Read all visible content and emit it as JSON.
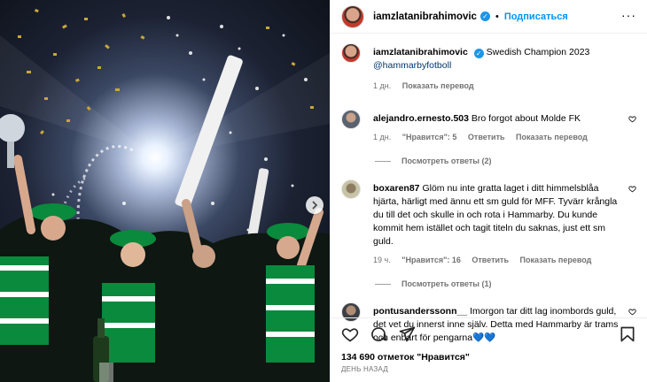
{
  "post": {
    "username": "iamzlatanibrahimovic",
    "follow_label": "Подписаться",
    "dot": "•",
    "caption_text": "Swedish Champion 2023",
    "caption_tag": "@hammarbyfotboll",
    "caption_time": "1 дн.",
    "caption_translate": "Показать перевод"
  },
  "comments": [
    {
      "user": "alejandro.ernesto.503",
      "text": "Bro forgot about Molde FK",
      "time": "1 дн.",
      "likes": "\"Нравится\": 5",
      "reply": "Ответить",
      "translate": "Показать перевод",
      "replies": "Посмотреть ответы (2)"
    },
    {
      "user": "boxaren87",
      "text": "Glöm nu inte gratta laget i ditt himmelsblåa hjärta, härligt med ännu ett sm guld för MFF. Tyvärr krångla du till det och skulle in och rota i Hammarby. Du kunde kommit hem istället och tagit titeln du saknas, just ett sm guld.",
      "time": "19 ч.",
      "likes": "\"Нравится\": 16",
      "reply": "Ответить",
      "translate": "Показать перевод",
      "replies": "Посмотреть ответы (1)"
    },
    {
      "user": "pontusanderssonn__",
      "text": "Imorgon tar ditt lag inombords guld, det vet du innerst inne själv. Detta med Hammarby är trams och enbart för pengarna💙💙"
    }
  ],
  "actions": {
    "likes": "134 690 отметок \"Нравится\"",
    "date": "ДЕНЬ НАЗАД"
  },
  "colors": {
    "accent": "#0095f6",
    "verified": "#1c96e8",
    "secondary_text": "#737373",
    "link": "#00376b",
    "hammarby_green": "#0a8a3c"
  }
}
